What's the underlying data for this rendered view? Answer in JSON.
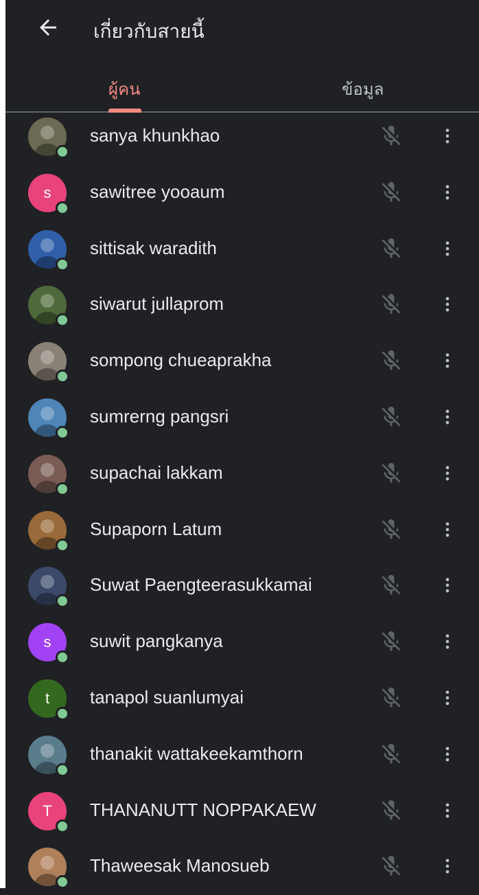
{
  "header": {
    "title": "เกี่ยวกับสายนี้",
    "back_icon": "arrow-back-icon"
  },
  "tabs": [
    {
      "label": "ผู้คน",
      "active": true
    },
    {
      "label": "ข้อมูล",
      "active": false
    }
  ],
  "colors": {
    "background": "#202124",
    "accent": "#f28b82",
    "online": "#81c995"
  },
  "participants": [
    {
      "name": "sanya khunkhao",
      "avatar": "photo",
      "tone": "#6b6a52",
      "mic": "mic-off-icon"
    },
    {
      "name": "sawitree yooaum",
      "avatar": "s",
      "tone": "#e8437b",
      "mic": "mic-off-icon"
    },
    {
      "name": "sittisak waradith",
      "avatar": "photo",
      "tone": "#2f5fa8",
      "mic": "mic-off-icon"
    },
    {
      "name": "siwarut jullaprom",
      "avatar": "photo",
      "tone": "#4f6a3a",
      "mic": "mic-off-icon"
    },
    {
      "name": "sompong chueaprakha",
      "avatar": "photo",
      "tone": "#8a8276",
      "mic": "mic-off-icon"
    },
    {
      "name": "sumrerng pangsri",
      "avatar": "photo",
      "tone": "#4e86b8",
      "mic": "mic-off-icon"
    },
    {
      "name": "supachai lakkam",
      "avatar": "photo",
      "tone": "#7a5c55",
      "mic": "mic-off-icon"
    },
    {
      "name": "Supaporn Latum",
      "avatar": "photo",
      "tone": "#9a6a3a",
      "mic": "mic-off-icon"
    },
    {
      "name": "Suwat Paengteerasukkamai",
      "avatar": "photo",
      "tone": "#3b4a6a",
      "mic": "mic-off-icon"
    },
    {
      "name": "suwit pangkanya",
      "avatar": "s",
      "tone": "#a142f4",
      "mic": "mic-off-icon"
    },
    {
      "name": "tanapol suanlumyai",
      "avatar": "t",
      "tone": "#33691e",
      "mic": "mic-off-icon"
    },
    {
      "name": "thanakit wattakeekamthorn",
      "avatar": "photo",
      "tone": "#5a7d8c",
      "mic": "mic-off-icon"
    },
    {
      "name": "THANANUTT NOPPAKAEW",
      "avatar": "T",
      "tone": "#e8437b",
      "mic": "mic-off-icon"
    },
    {
      "name": "Thaweesak Manosueb",
      "avatar": "photo",
      "tone": "#b0805a",
      "mic": "mic-off-icon"
    }
  ]
}
